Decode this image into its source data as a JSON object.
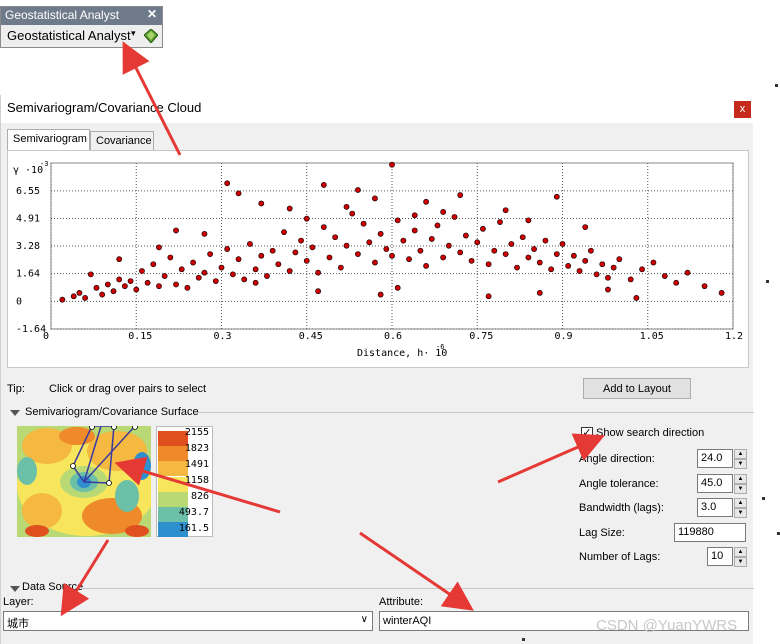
{
  "toolbar": {
    "title": "Geostatistical Analyst",
    "close": "✕",
    "menu_label": "Geostatistical Analyst",
    "caret": "▾",
    "icon": "geostat-diamond-icon"
  },
  "dialog": {
    "title": "Semivariogram/Covariance Cloud",
    "close": "x",
    "tabs": [
      {
        "label": "Semivariogram",
        "active": true
      },
      {
        "label": "Covariance",
        "active": false
      }
    ],
    "tip_label": "Tip:",
    "tip_text": "Click or drag over pairs to select",
    "add_to_layout": "Add to Layout"
  },
  "chart_data": {
    "type": "scatter",
    "title": "",
    "ylabel": "γ ·10",
    "ylabel_exp": "-3",
    "xlabel": "Distance, h· 10",
    "xlabel_exp": "-6",
    "xlim": [
      0,
      1.2
    ],
    "ylim": [
      -1.64,
      8.2
    ],
    "xticks": [
      "0",
      "0.15",
      "0.3",
      "0.45",
      "0.6",
      "0.75",
      "0.9",
      "1.05",
      "1.2"
    ],
    "yticks": [
      "6.55",
      "4.91",
      "3.28",
      "1.64",
      "0",
      "-1.64"
    ],
    "grid": true,
    "marker_color": "#cc0000",
    "series": [
      {
        "x": [
          0.02,
          0.04,
          0.05,
          0.06,
          0.07,
          0.08,
          0.09,
          0.1,
          0.11,
          0.12,
          0.13,
          0.14,
          0.15,
          0.16,
          0.17,
          0.18,
          0.19,
          0.2,
          0.21,
          0.22,
          0.23,
          0.24,
          0.25,
          0.26,
          0.27,
          0.28,
          0.29,
          0.3,
          0.31,
          0.32,
          0.33,
          0.34,
          0.35,
          0.36,
          0.37,
          0.38,
          0.39,
          0.4,
          0.41,
          0.42,
          0.43,
          0.44,
          0.45,
          0.46,
          0.47,
          0.48,
          0.49,
          0.5,
          0.51,
          0.52,
          0.53,
          0.54,
          0.55,
          0.56,
          0.57,
          0.58,
          0.59,
          0.6,
          0.61,
          0.62,
          0.63,
          0.64,
          0.65,
          0.66,
          0.67,
          0.68,
          0.69,
          0.7,
          0.71,
          0.72,
          0.73,
          0.74,
          0.75,
          0.76,
          0.77,
          0.78,
          0.79,
          0.8,
          0.81,
          0.82,
          0.83,
          0.84,
          0.85,
          0.86,
          0.87,
          0.88,
          0.89,
          0.9,
          0.91,
          0.92,
          0.93,
          0.94,
          0.95,
          0.96,
          0.97,
          0.98,
          0.99,
          1.0,
          1.02,
          1.04,
          1.06,
          1.08,
          1.1,
          1.12,
          1.15,
          1.18,
          0.31,
          0.6,
          0.22,
          0.54,
          0.89,
          0.48,
          0.33,
          0.37,
          0.42,
          0.57,
          0.66,
          0.72,
          0.8,
          0.45,
          0.52,
          0.64,
          0.69,
          0.84,
          0.94,
          0.27,
          0.19,
          0.12,
          0.36,
          0.47,
          0.58,
          0.61,
          0.77,
          0.86,
          0.98,
          1.03
        ],
        "y": [
          0.1,
          0.3,
          0.5,
          0.2,
          1.6,
          0.8,
          0.4,
          1.0,
          0.6,
          1.3,
          0.9,
          1.2,
          0.7,
          1.8,
          1.1,
          2.2,
          0.9,
          1.5,
          2.6,
          1.0,
          1.9,
          0.8,
          2.3,
          1.4,
          1.7,
          2.8,
          1.2,
          2.0,
          3.1,
          1.6,
          2.5,
          1.3,
          3.4,
          1.9,
          2.7,
          1.5,
          3.0,
          2.2,
          4.1,
          1.8,
          2.9,
          3.6,
          2.4,
          3.2,
          1.7,
          4.4,
          2.6,
          3.8,
          2.0,
          3.3,
          5.2,
          2.8,
          4.6,
          3.5,
          2.3,
          4.0,
          3.1,
          2.7,
          4.8,
          3.6,
          2.5,
          4.2,
          3.0,
          2.1,
          3.7,
          4.5,
          2.6,
          3.3,
          5.0,
          2.9,
          3.9,
          2.4,
          3.5,
          4.3,
          2.2,
          3.0,
          4.7,
          2.8,
          3.4,
          2.0,
          3.8,
          2.6,
          3.1,
          2.3,
          3.6,
          1.9,
          2.8,
          3.4,
          2.1,
          2.7,
          1.8,
          2.4,
          3.0,
          1.6,
          2.2,
          1.4,
          2.0,
          2.5,
          1.3,
          1.9,
          2.3,
          1.5,
          1.1,
          1.7,
          0.9,
          0.5,
          7.0,
          8.1,
          4.2,
          6.6,
          6.2,
          6.9,
          6.4,
          5.8,
          5.5,
          6.1,
          5.9,
          6.3,
          5.4,
          4.9,
          5.6,
          5.1,
          5.3,
          4.8,
          4.4,
          4.0,
          3.2,
          2.5,
          1.1,
          0.6,
          0.4,
          0.8,
          0.3,
          0.5,
          0.7,
          0.2
        ]
      }
    ]
  },
  "surface": {
    "header": "Semivariogram/Covariance Surface",
    "legend_values": [
      "2155",
      "1823",
      "1491",
      "1158",
      "826",
      "493.7",
      "161.5"
    ],
    "legend_colors": [
      "#e0501e",
      "#ee8a2a",
      "#f5b840",
      "#f7e65b",
      "#b9d975",
      "#6cc0a8",
      "#2e8fce"
    ],
    "show_search_direction_label": "Show search direction",
    "show_search_direction_checked": true,
    "fields": [
      {
        "label": "Angle direction:",
        "value": "24.0",
        "spinner": true
      },
      {
        "label": "Angle tolerance:",
        "value": "45.0",
        "spinner": true
      },
      {
        "label": "Bandwidth (lags):",
        "value": "3.0",
        "spinner": true
      },
      {
        "label": "Lag Size:",
        "value": "119880",
        "spinner": false
      },
      {
        "label": "Number of Lags:",
        "value": "10",
        "spinner": true
      }
    ]
  },
  "data_source": {
    "header": "Data Source",
    "layer_label": "Layer:",
    "layer_value": "城市",
    "attribute_label": "Attribute:",
    "attribute_value": "winterAQI"
  },
  "annotation_color": "#e53935",
  "watermark": "CSDN @YuanYWRS"
}
